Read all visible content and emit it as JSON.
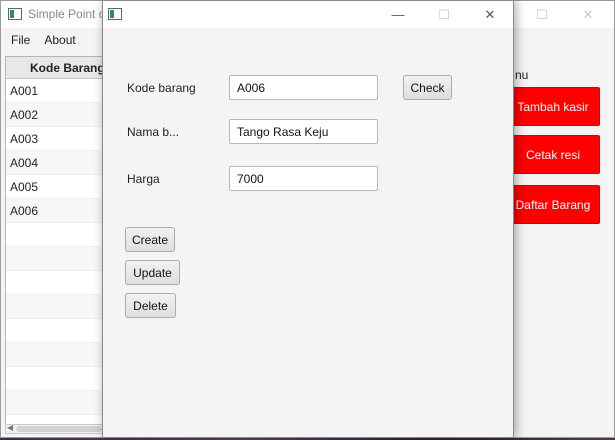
{
  "main_window": {
    "title": "Simple Point of Sales",
    "menu": [
      "File",
      "About"
    ],
    "table": {
      "header": "Kode Barang",
      "rows": [
        "A001",
        "A002",
        "A003",
        "A004",
        "A005",
        "A006"
      ]
    },
    "side_menu": {
      "label": "nu",
      "buttons": [
        "Tambah kasir",
        "Cetak resi",
        "Daftar Barang"
      ],
      "button_color": "#ff0000"
    }
  },
  "dialog": {
    "fields": {
      "kode_label": "Kode barang",
      "kode_value": "A006",
      "nama_label": "Nama b...",
      "nama_value": "Tango Rasa Keju",
      "harga_label": "Harga",
      "harga_value": "7000"
    },
    "buttons": {
      "check": "Check",
      "create": "Create",
      "update": "Update",
      "delete": "Delete"
    },
    "controls": {
      "minimize": "—",
      "maximize": "☐",
      "close": "✕"
    }
  }
}
